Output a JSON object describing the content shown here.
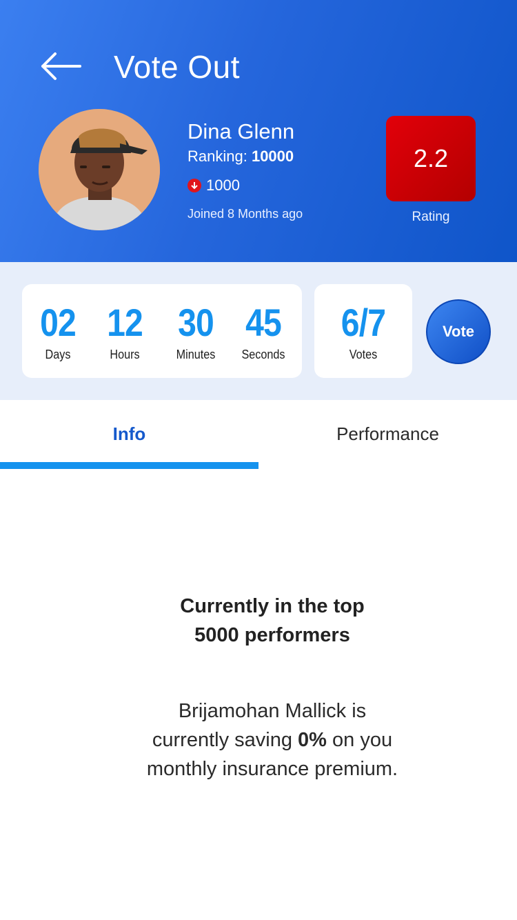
{
  "header": {
    "title": "Vote Out"
  },
  "profile": {
    "name": "Dina Glenn",
    "ranking_label": "Ranking: ",
    "ranking_value": "10000",
    "coins": "1000",
    "joined": "Joined 8 Months ago",
    "rating": "2.2",
    "rating_label": "Rating"
  },
  "countdown": {
    "days": "02",
    "days_label": "Days",
    "hours": "12",
    "hours_label": "Hours",
    "minutes": "30",
    "minutes_label": "Minutes",
    "seconds": "45",
    "seconds_label": "Seconds"
  },
  "votes": {
    "value": "6/7",
    "label": "Votes"
  },
  "vote_button": "Vote",
  "tabs": [
    {
      "label": "Info",
      "active": true
    },
    {
      "label": "Performance",
      "active": false
    }
  ],
  "info": {
    "headline_line1": "Currently in the top",
    "headline_line2": "5000 performers",
    "body_line1": "Brijamohan Mallick is",
    "body_line2_pre": "currently saving ",
    "body_line2_bold": "0%",
    "body_line2_post": " on you",
    "body_line3": "monthly insurance premium."
  },
  "colors": {
    "accent": "#1592ee",
    "brand": "#2566dc",
    "rating_bg": "#d4000a",
    "down_icon": "#e0151c"
  },
  "icons": {
    "back": "arrow-left-icon",
    "coin_change": "arrow-down-circle-icon"
  }
}
